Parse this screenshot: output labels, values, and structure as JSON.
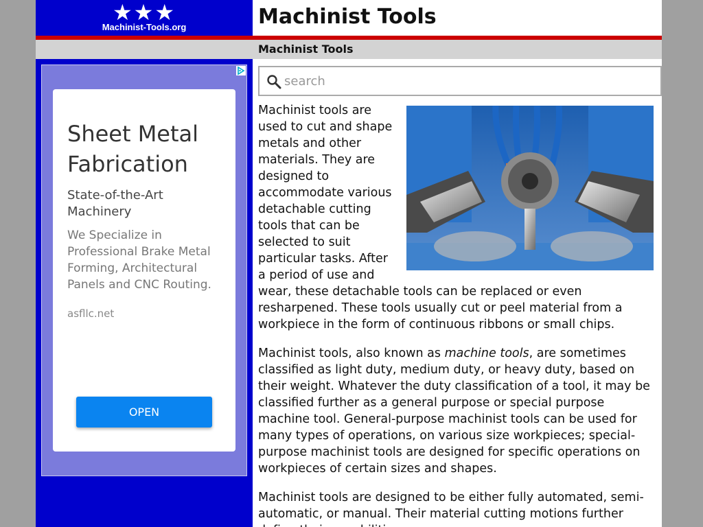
{
  "logo": {
    "stars": "★★★",
    "text": "Machinist-Tools.org"
  },
  "header": {
    "title": "Machinist Tools"
  },
  "breadcrumb": {
    "label": "Machinist Tools"
  },
  "ad": {
    "headline": "Sheet Metal Fabrication",
    "subheadline": "State-of-the-Art Machinery",
    "body": "We Specialize in Professional Brake Metal Forming, Architectural Panels and CNC Routing.",
    "url": "asfllc.net",
    "button_label": "OPEN"
  },
  "search": {
    "placeholder": "search",
    "value": ""
  },
  "content": {
    "p1": "Machinist tools are used to cut and shape metals and other materials.  They are designed to accommodate various detachable cutting tools that can be selected to suit particular tasks.  After a period of use and wear, these detachable tools can be replaced or even resharpened.  These tools usually cut or peel material from a workpiece in the form of continuous ribbons or small chips.",
    "p2_before": "Machinist tools, also known as ",
    "p2_em": "machine tools",
    "p2_after": ", are sometimes classified as light duty, medium duty, or heavy duty, based on their weight.  Whatever the duty classification of a tool, it may be classified further as a general purpose or special purpose machine tool.  General-purpose machinist tools can be used for many types of operations, on various size workpieces; special-purpose machinist tools are designed for specific operations on workpieces of certain sizes and shapes.",
    "p3": "Machinist tools are designed to be either fully automated, semi-automatic, or manual.  Their material cutting motions further define their capabilities."
  }
}
